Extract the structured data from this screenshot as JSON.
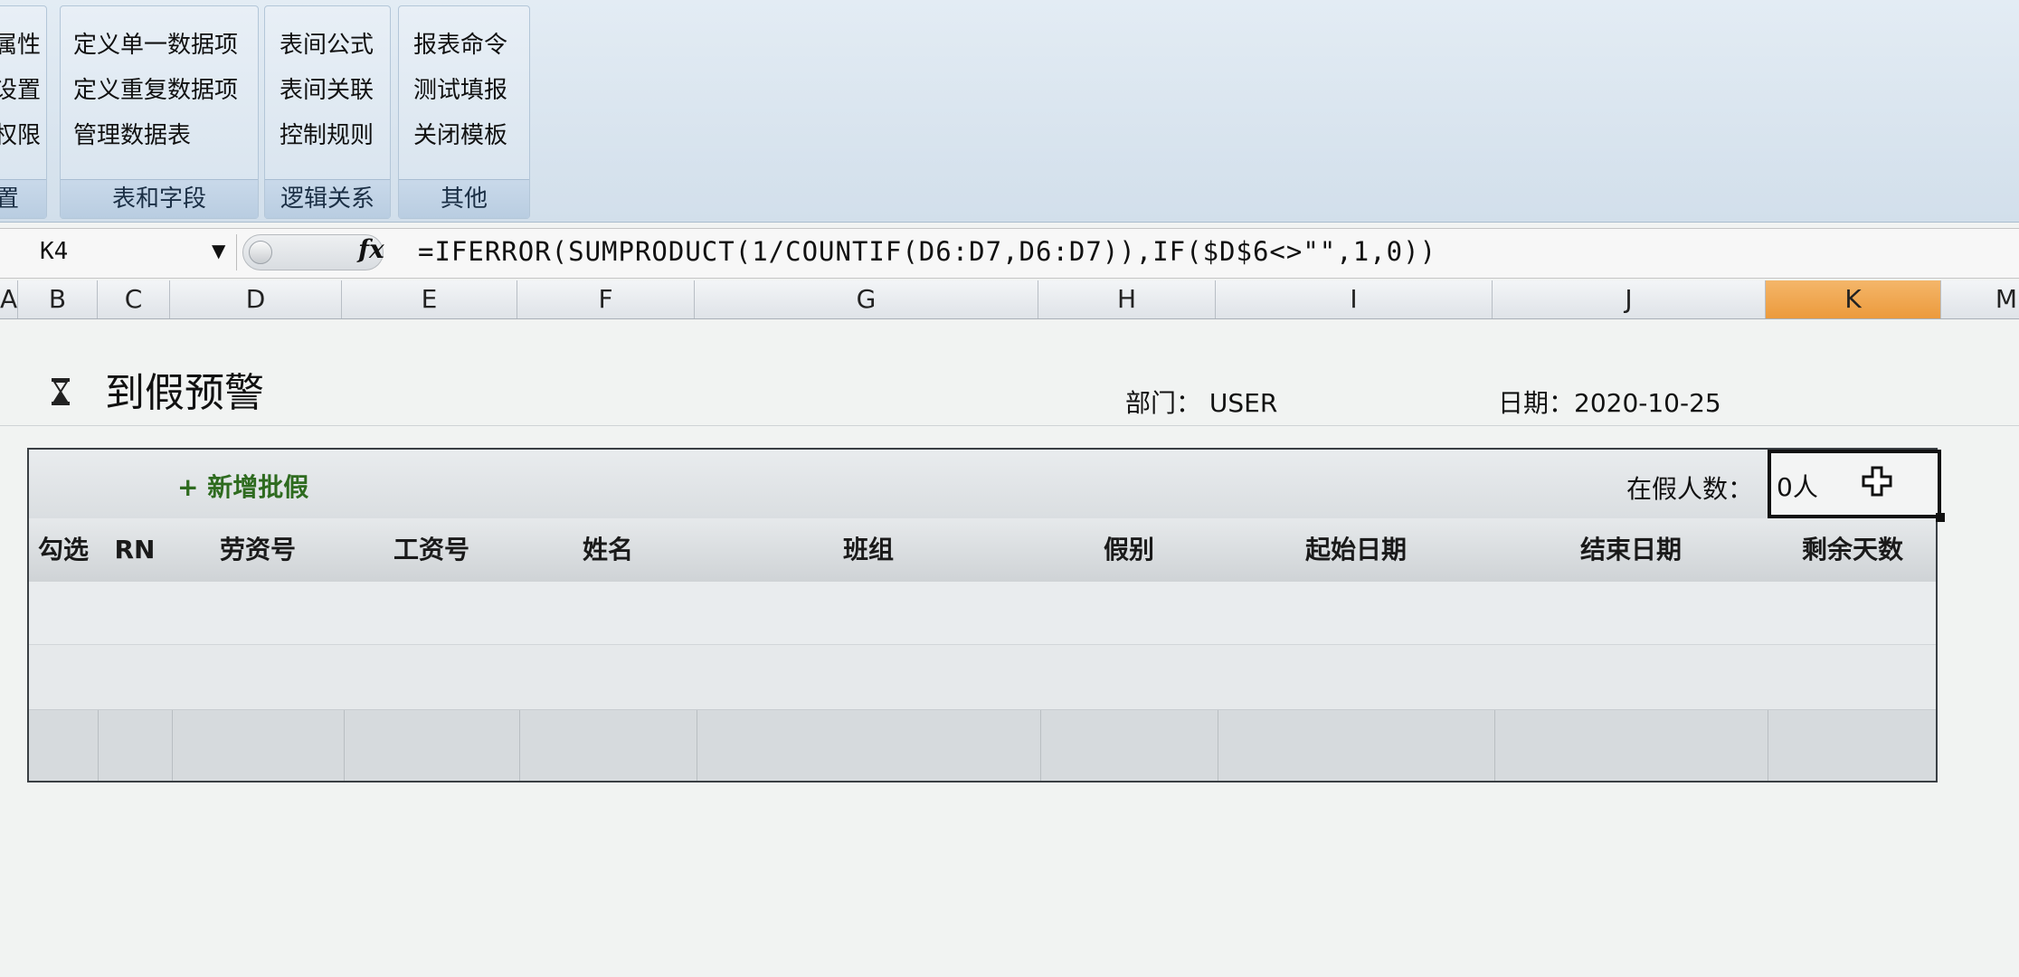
{
  "ribbon": {
    "groups": [
      {
        "items": [
          "属性",
          "设置",
          "权限"
        ],
        "label": "置"
      },
      {
        "items": [
          "定义单一数据项",
          "定义重复数据项",
          "管理数据表"
        ],
        "label": "表和字段"
      },
      {
        "items": [
          "表间公式",
          "表间关联",
          "控制规则"
        ],
        "label": "逻辑关系"
      },
      {
        "items": [
          "报表命令",
          "测试填报",
          "关闭模板"
        ],
        "label": "其他"
      }
    ]
  },
  "formula_bar": {
    "name_box": "K4",
    "fx": "fx",
    "formula": "=IFERROR(SUMPRODUCT(1/COUNTIF(D6:D7,D6:D7)),IF($D$6<>\"\",1,0))"
  },
  "columns": [
    "A",
    "B",
    "C",
    "D",
    "E",
    "F",
    "G",
    "H",
    "I",
    "J",
    "K",
    "M"
  ],
  "selected_column": "K",
  "sheet": {
    "title": "到假预警",
    "dept_label": "部门： USER",
    "date_label": "日期：2020-10-25",
    "add_button": "+ 新增批假",
    "count_label": "在假人数：",
    "count_value": "0人",
    "table_headers": [
      "勾选",
      "RN",
      "劳资号",
      "工资号",
      "姓名",
      "班组",
      "假别",
      "起始日期",
      "结束日期",
      "剩余天数"
    ]
  },
  "colors": {
    "accent": "#ec9a3c",
    "add_button": "#2e6b1f"
  }
}
